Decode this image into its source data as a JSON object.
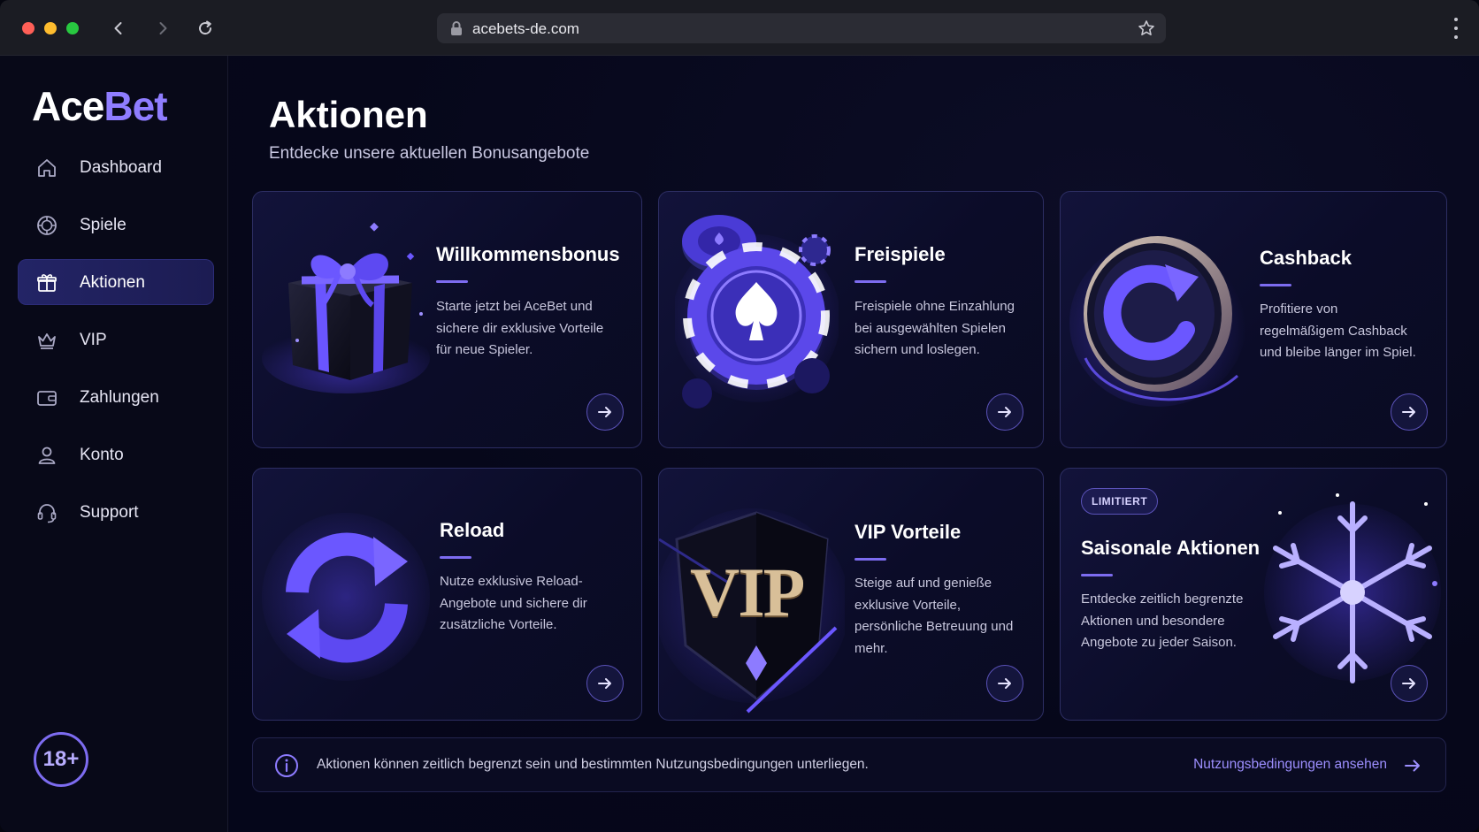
{
  "browser": {
    "url": "acebets-de.com"
  },
  "sidebar": {
    "logo": {
      "part1": "Ace",
      "part2": "Bet"
    },
    "items": [
      {
        "label": "Dashboard",
        "icon": "home-icon",
        "active": false
      },
      {
        "label": "Spiele",
        "icon": "chip-icon",
        "active": false
      },
      {
        "label": "Aktionen",
        "icon": "gift-icon",
        "active": true
      },
      {
        "label": "VIP",
        "icon": "crown-icon",
        "active": false
      },
      {
        "label": "Zahlungen",
        "icon": "wallet-icon",
        "active": false
      },
      {
        "label": "Konto",
        "icon": "user-icon",
        "active": false
      },
      {
        "label": "Support",
        "icon": "headset-icon",
        "active": false
      }
    ],
    "age_badge": "18+"
  },
  "main": {
    "title": "Aktionen",
    "subtitle": "Entdecke unsere aktuellen Bonusangebote",
    "cards": [
      {
        "title": "Willkommensbonus",
        "desc": "Starte jetzt bei AceBet und sichere dir exklusive Vorteile für neue Spieler.",
        "art": "gift-box-icon"
      },
      {
        "title": "Freispiele",
        "desc": "Freispiele ohne Einzahlung bei ausgewählten Spielen sichern und loslegen.",
        "art": "poker-chip-icon"
      },
      {
        "title": "Cashback",
        "desc": "Profitiere von regelmäßigem Cashback und bleibe länger im Spiel.",
        "art": "cashback-coin-icon"
      },
      {
        "title": "Reload",
        "desc": "Nutze exklusive Reload-Angebote und sichere dir zusätzliche Vorteile.",
        "art": "reload-arrows-icon"
      },
      {
        "title": "VIP Vorteile",
        "desc": "Steige auf und genieße exklusive Vorteile, persönliche Betreuung und mehr.",
        "art": "vip-emblem-icon",
        "art_text": "VIP"
      },
      {
        "title": "Saisonale Aktionen",
        "desc": "Entdecke zeitlich begrenzte Aktionen und besondere Angebote zu jeder Saison.",
        "art": "snowflake-icon",
        "badge": "LIMITIERT"
      }
    ]
  },
  "info": {
    "text": "Aktionen können zeitlich begrenzt sein und bestimmten Nutzungsbedingungen unterliegen.",
    "link": "Nutzungsbedingungen ansehen"
  },
  "colors": {
    "accent": "#7d6cf0",
    "accent_light": "#9d8fff",
    "background": "#06071a",
    "card_border": "#2d2e63"
  }
}
